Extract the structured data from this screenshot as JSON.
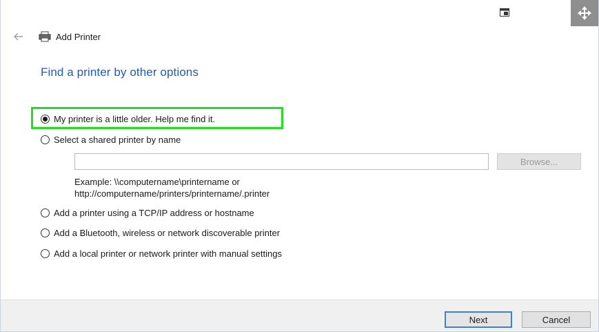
{
  "window": {
    "title": "Add Printer"
  },
  "icons": {
    "back": "back-arrow-icon",
    "printer": "printer-icon",
    "restore": "restore-window-icon",
    "move": "move-arrows-icon"
  },
  "main": {
    "heading": "Find a printer by other options",
    "options": [
      {
        "label": "My printer is a little older. Help me find it.",
        "checked": true
      },
      {
        "label": "Select a shared printer by name",
        "checked": false
      },
      {
        "label": "Add a printer using a TCP/IP address or hostname",
        "checked": false
      },
      {
        "label": "Add a Bluetooth, wireless or network discoverable printer",
        "checked": false
      },
      {
        "label": "Add a local printer or network printer with manual settings",
        "checked": false
      }
    ],
    "shared_printer": {
      "value": "",
      "placeholder": "",
      "browse_label": "Browse...",
      "example_line1": "Example: \\\\computername\\printername or",
      "example_line2": "http://computername/printers/printername/.printer"
    }
  },
  "footer": {
    "next_label": "Next",
    "cancel_label": "Cancel"
  },
  "colors": {
    "heading": "#1e5bb8",
    "highlight": "#22dd22",
    "next_border": "#3c7fd6"
  }
}
